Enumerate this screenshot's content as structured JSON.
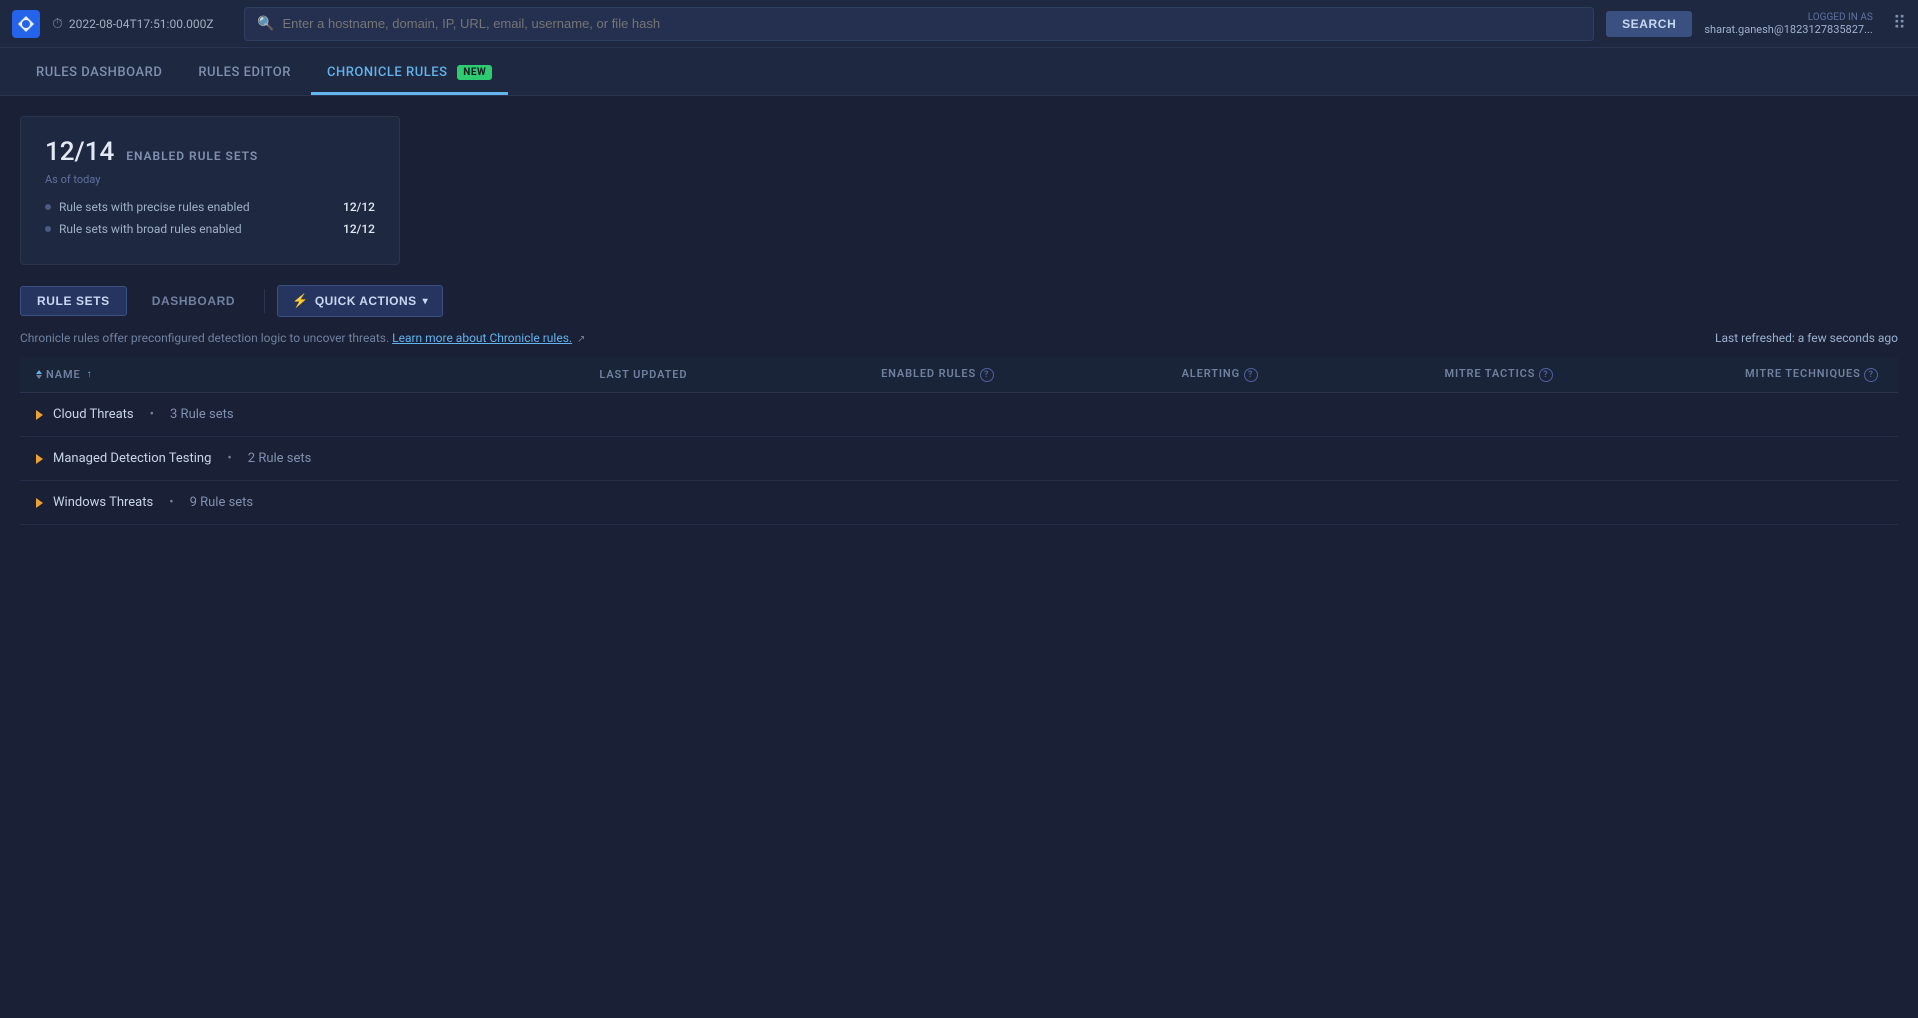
{
  "topbar": {
    "time": "2022-08-04T17:51:00.000Z",
    "search_placeholder": "Enter a hostname, domain, IP, URL, email, username, or file hash",
    "search_btn": "SEARCH",
    "logged_in_label": "LOGGED IN AS",
    "username": "sharat.ganesh@1823127835827..."
  },
  "secondary_nav": {
    "tabs": [
      {
        "id": "rules-dashboard",
        "label": "RULES DASHBOARD",
        "active": false
      },
      {
        "id": "rules-editor",
        "label": "RULES EDITOR",
        "active": false
      },
      {
        "id": "chronicle-rules",
        "label": "CHRONICLE RULES",
        "active": true,
        "badge": "NEW"
      }
    ]
  },
  "summary_card": {
    "count": "12/14",
    "title": "ENABLED RULE SETS",
    "subtitle": "As of today",
    "rows": [
      {
        "label": "Rule sets with precise rules enabled",
        "value": "12/12"
      },
      {
        "label": "Rule sets with broad rules enabled",
        "value": "12/12"
      }
    ]
  },
  "toolbar": {
    "rule_sets_label": "RULE SETS",
    "dashboard_label": "DASHBOARD",
    "quick_actions_label": "QUICK ACTIONS"
  },
  "info_bar": {
    "text": "Chronicle rules offer preconfigured detection logic to uncover threats.",
    "link_text": "Learn more about Chronicle rules.",
    "last_refreshed_label": "Last refreshed:",
    "last_refreshed_value": "a few seconds ago"
  },
  "table": {
    "columns": [
      {
        "id": "name",
        "label": "NAME",
        "sortable": true,
        "sort_dir": "asc"
      },
      {
        "id": "last_updated",
        "label": "LAST UPDATED",
        "sortable": false
      },
      {
        "id": "enabled_rules",
        "label": "ENABLED RULES",
        "has_help": true
      },
      {
        "id": "alerting",
        "label": "ALERTING",
        "has_help": true
      },
      {
        "id": "mitre_tactics",
        "label": "MITRE TACTICS",
        "has_help": true
      },
      {
        "id": "mitre_techniques",
        "label": "MITRE TECHNIQUES",
        "has_help": true
      }
    ],
    "rows": [
      {
        "name": "Cloud Threats",
        "rule_count": "3 Rule sets"
      },
      {
        "name": "Managed Detection Testing",
        "rule_count": "2 Rule sets"
      },
      {
        "name": "Windows Threats",
        "rule_count": "9 Rule sets"
      }
    ]
  }
}
